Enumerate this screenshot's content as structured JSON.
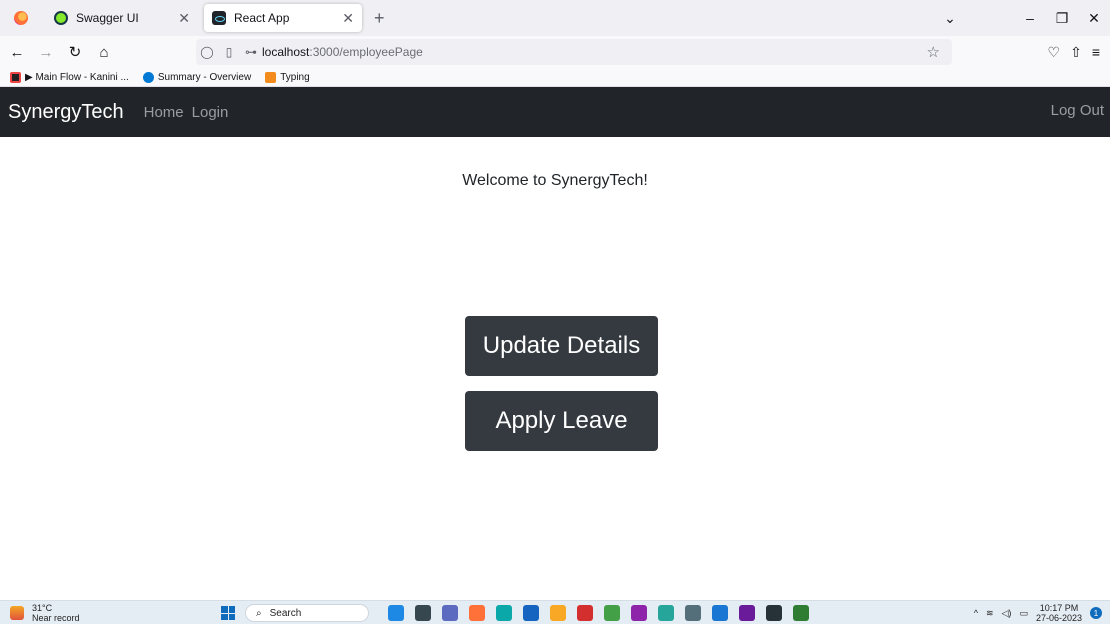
{
  "browser": {
    "tabs": [
      {
        "title": "Swagger UI"
      },
      {
        "title": "React App"
      }
    ],
    "url_host": "localhost",
    "url_path": ":3000/employeePage",
    "bookmarks": [
      "▶ Main Flow - Kanini ...",
      "Summary - Overview",
      "Typing"
    ]
  },
  "navbar": {
    "brand": "SynergyTech",
    "links": [
      "Home",
      "Login"
    ],
    "logout": "Log Out"
  },
  "main": {
    "welcome": "Welcome to SynergyTech!",
    "update_button": "Update Details",
    "leave_button": "Apply Leave"
  },
  "taskbar": {
    "temperature": "31°C",
    "weather_text": "Near record",
    "search_label": "Search",
    "time": "10:17 PM",
    "date": "27-06-2023",
    "notification_count": "1",
    "app_colors": [
      "#1e88e5",
      "#37474f",
      "#5c6bc0",
      "#ff7139",
      "#0aa8a8",
      "#1565c0",
      "#f9a825",
      "#d32f2f",
      "#43a047",
      "#8e24aa",
      "#26a69a",
      "#546e7a",
      "#1976d2",
      "#6a1b9a",
      "#263238",
      "#2e7d32"
    ]
  }
}
